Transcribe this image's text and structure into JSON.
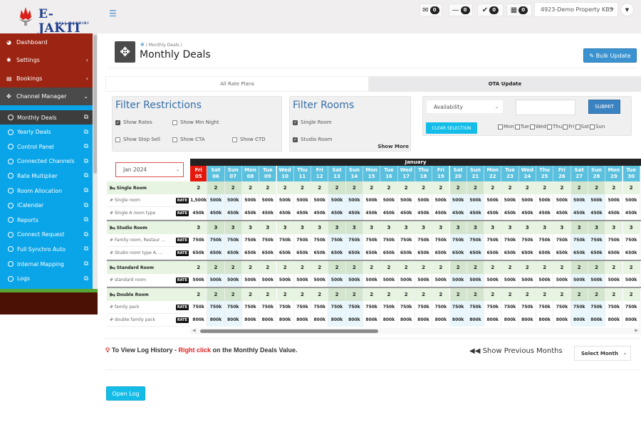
{
  "header": {
    "logo_text": "E-JAKTI",
    "logo_subtext": "BALI MANDIRI",
    "menu_icon": "hamburger-icon",
    "badges": [
      {
        "icon": "envelope-open-icon",
        "glyph": "✉",
        "count": "0"
      },
      {
        "icon": "minus-icon",
        "glyph": "—",
        "count": "0"
      },
      {
        "icon": "check-icon",
        "glyph": "✔",
        "count": "0"
      },
      {
        "icon": "calendar-icon",
        "glyph": "▦",
        "count": "0"
      }
    ],
    "property_select": "4923-Demo Property KBS",
    "user_menu_glyph": "▼"
  },
  "sidebar": {
    "main_items": [
      {
        "label": "Dashboard",
        "icon": "tachometer-icon",
        "glyph": "◕",
        "chevron": ""
      },
      {
        "label": "Settings",
        "icon": "gear-icon",
        "glyph": "✱",
        "chevron": "›"
      },
      {
        "label": "Bookings",
        "icon": "keyboard-icon",
        "glyph": "▤",
        "chevron": "›"
      },
      {
        "label": "Channel Manager",
        "icon": "arrows-icon",
        "glyph": "✥",
        "chevron": "⌄"
      }
    ],
    "sub_items": [
      {
        "label": "Monthly Deals",
        "active": true
      },
      {
        "label": "Yearly Deals"
      },
      {
        "label": "Control Panel"
      },
      {
        "label": "Connected Channels"
      },
      {
        "label": "Rate Multiplier"
      },
      {
        "label": "Room Allocation"
      },
      {
        "label": "iCalendar"
      },
      {
        "label": "Reports"
      },
      {
        "label": "Connect Request"
      },
      {
        "label": "Full Synchro Auto"
      },
      {
        "label": "Internal Mapping"
      },
      {
        "label": "Logs"
      }
    ]
  },
  "page": {
    "breadcrumb": [
      "Monthly Deals"
    ],
    "title": "Monthly Deals",
    "bulk_update": "Bulk Update",
    "tabs": [
      "All Rate Plans",
      "OTA Update"
    ]
  },
  "filters": {
    "restrictions_title": "Filter Restrictions",
    "restrictions": [
      {
        "label": "Show Rates",
        "checked": true
      },
      {
        "label": "Show Min Night",
        "checked": false
      },
      {
        "label": "Show Stop Sell",
        "checked": false
      },
      {
        "label": "Show CTA",
        "checked": false
      },
      {
        "label": "Show CTD",
        "checked": false
      }
    ],
    "rooms_title": "Filter Rooms",
    "rooms": [
      {
        "label": "Single Room",
        "checked": true
      },
      {
        "label": "Studio Room",
        "checked": true
      }
    ],
    "show_more": "Show More"
  },
  "bulk": {
    "type_select": "Availability",
    "value_input": "",
    "submit": "SUBMIT",
    "clear": "CLEAR SELECTION",
    "days": [
      "Mon",
      "Tue",
      "Wed",
      "Thu",
      "Fri",
      "Sat",
      "Sun"
    ]
  },
  "calendar": {
    "month_select": "Jan 2024",
    "month_label": "January",
    "days": [
      {
        "dow": "Fri",
        "d": "05",
        "today": true
      },
      {
        "dow": "Sat",
        "d": "06",
        "we": true
      },
      {
        "dow": "Sun",
        "d": "07",
        "we": true
      },
      {
        "dow": "Mon",
        "d": "08"
      },
      {
        "dow": "Tue",
        "d": "09"
      },
      {
        "dow": "Wed",
        "d": "10"
      },
      {
        "dow": "Thu",
        "d": "11"
      },
      {
        "dow": "Fri",
        "d": "12"
      },
      {
        "dow": "Sat",
        "d": "13",
        "we": true
      },
      {
        "dow": "Sun",
        "d": "14",
        "we": true
      },
      {
        "dow": "Mon",
        "d": "15"
      },
      {
        "dow": "Tue",
        "d": "16"
      },
      {
        "dow": "Wed",
        "d": "17"
      },
      {
        "dow": "Thu",
        "d": "18"
      },
      {
        "dow": "Fri",
        "d": "19"
      },
      {
        "dow": "Sat",
        "d": "20",
        "we": true
      },
      {
        "dow": "Sun",
        "d": "21",
        "we": true
      },
      {
        "dow": "Mon",
        "d": "22"
      },
      {
        "dow": "Tue",
        "d": "23"
      },
      {
        "dow": "Wed",
        "d": "24"
      },
      {
        "dow": "Thu",
        "d": "25"
      },
      {
        "dow": "Fri",
        "d": "26"
      },
      {
        "dow": "Sat",
        "d": "27",
        "we": true
      },
      {
        "dow": "Sun",
        "d": "28",
        "we": true
      },
      {
        "dow": "Mon",
        "d": "29"
      },
      {
        "dow": "Tue",
        "d": "30"
      }
    ],
    "rate_badge": "RATE",
    "rooms": [
      {
        "name": "Single Room",
        "availability": "2",
        "plans": [
          {
            "name": "Single room",
            "rate": "500k",
            "first_rate": "1,500k"
          },
          {
            "name": "Single A room type",
            "rate": "450k"
          }
        ]
      },
      {
        "name": "Studio Room",
        "availability": "3",
        "plans": [
          {
            "name": "Family room, Restaur ...",
            "rate": "750k"
          },
          {
            "name": "Studio room type A, ...",
            "rate": "650k"
          }
        ]
      },
      {
        "name": "Standard Room",
        "availability": "2",
        "plans": [
          {
            "name": "standard room",
            "rate": "500k"
          }
        ]
      },
      {
        "name": "Double Room",
        "availability": "2",
        "plans": [
          {
            "name": "family pack",
            "rate": "750k"
          },
          {
            "name": "double family pack",
            "rate": "800k"
          }
        ]
      }
    ]
  },
  "footer": {
    "tip_prefix": "To View Log History - ",
    "tip_highlight": "Right click",
    "tip_suffix": " on the Monthly Deals Value.",
    "show_previous": "Show Previous Months",
    "select_month": "Select Month",
    "open_log": "Open Log"
  },
  "colors": {
    "sidebar_red": "#9b2412",
    "sidebar_blue": "#0aa5e8",
    "header_day": "#5bc0de",
    "today": "#e6180c",
    "accent_blue": "#3a93d0"
  }
}
